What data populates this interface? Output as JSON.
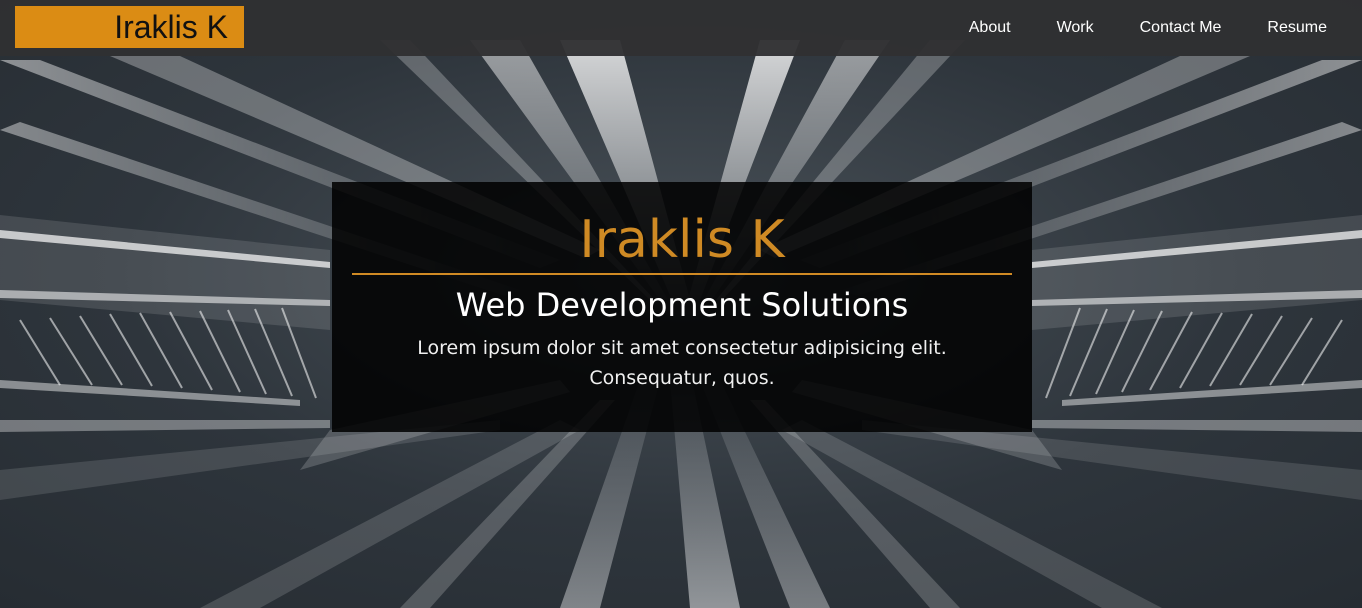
{
  "nav": {
    "brand": "Iraklis K",
    "links": [
      {
        "label": "About"
      },
      {
        "label": "Work"
      },
      {
        "label": "Contact Me"
      },
      {
        "label": "Resume"
      }
    ]
  },
  "hero": {
    "title": "Iraklis K",
    "subtitle": "Web Development Solutions",
    "text": "Lorem ipsum dolor sit amet consectetur adipisicing elit. Consequatur, quos."
  },
  "colors": {
    "accent": "#db8c14",
    "title": "#cf8a24",
    "navbar": "#303032",
    "overlay": "#000000"
  }
}
